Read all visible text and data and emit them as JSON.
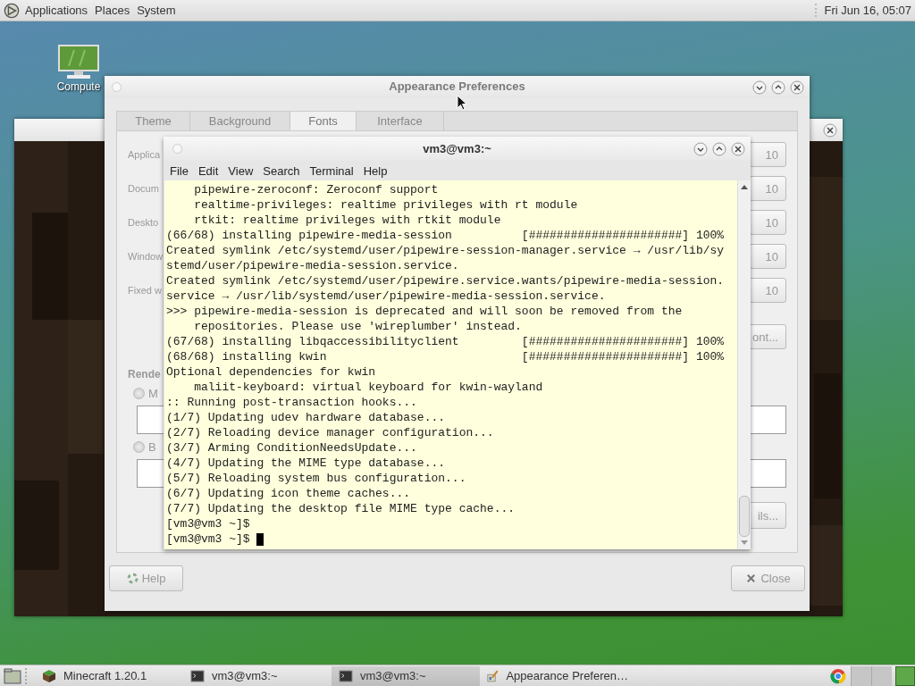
{
  "top_panel": {
    "menus": [
      "Applications",
      "Places",
      "System"
    ],
    "clock": "Fri Jun 16, 05:07"
  },
  "desktop_icons": [
    {
      "label": "Compute"
    }
  ],
  "appearance_window": {
    "title": "Appearance Preferences",
    "tabs": [
      {
        "label": "Theme",
        "selected": false
      },
      {
        "label": "Background",
        "selected": false
      },
      {
        "label": "Fonts",
        "selected": true
      },
      {
        "label": "Interface",
        "selected": false
      }
    ],
    "font_rows": [
      {
        "label": "Applica",
        "size": "10"
      },
      {
        "label": "Docum",
        "size": "10"
      },
      {
        "label": "Deskto",
        "size": "10"
      },
      {
        "label": "Window",
        "size": "10"
      },
      {
        "label": "Fixed w",
        "size": "10"
      }
    ],
    "font_button": "ont...",
    "rendering_label": "Rende",
    "rendering_options": [
      {
        "label": "M",
        "selected": false
      },
      {
        "label": "B",
        "selected": false
      }
    ],
    "details_button": "ils...",
    "buttons": [
      {
        "label": "Help",
        "kind": "help"
      },
      {
        "label": "Close",
        "kind": "close"
      }
    ]
  },
  "terminal": {
    "title": "vm3@vm3:~",
    "menus": [
      "File",
      "Edit",
      "View",
      "Search",
      "Terminal",
      "Help"
    ],
    "lines": [
      "    pipewire-zeroconf: Zeroconf support",
      "    realtime-privileges: realtime privileges with rt module",
      "    rtkit: realtime privileges with rtkit module",
      "(66/68) installing pipewire-media-session          [######################] 100%",
      "Created symlink /etc/systemd/user/pipewire-session-manager.service → /usr/lib/sy",
      "stemd/user/pipewire-media-session.service.",
      "Created symlink /etc/systemd/user/pipewire.service.wants/pipewire-media-session.",
      "service → /usr/lib/systemd/user/pipewire-media-session.service.",
      ">>> pipewire-media-session is deprecated and will soon be removed from the",
      "    repositories. Please use 'wireplumber' instead.",
      "(67/68) installing libqaccessibilityclient         [######################] 100%",
      "(68/68) installing kwin                            [######################] 100%",
      "Optional dependencies for kwin",
      "    maliit-keyboard: virtual keyboard for kwin-wayland",
      ":: Running post-transaction hooks...",
      "(1/7) Updating udev hardware database...",
      "(2/7) Reloading device manager configuration...",
      "(3/7) Arming ConditionNeedsUpdate...",
      "(4/7) Updating the MIME type database...",
      "(5/7) Reloading system bus configuration...",
      "(6/7) Updating icon theme caches...",
      "(7/7) Updating the desktop file MIME type cache...",
      "[vm3@vm3 ~]$",
      "[vm3@vm3 ~]$ "
    ]
  },
  "taskbar": {
    "tasks": [
      {
        "label": "Minecraft 1.20.1",
        "kind": "game",
        "selected": false
      },
      {
        "label": "vm3@vm3:~",
        "kind": "terminal",
        "selected": false
      },
      {
        "label": "vm3@vm3:~",
        "kind": "terminal",
        "selected": true
      },
      {
        "label": "Appearance Preferen…",
        "kind": "settings",
        "selected": false
      }
    ]
  }
}
